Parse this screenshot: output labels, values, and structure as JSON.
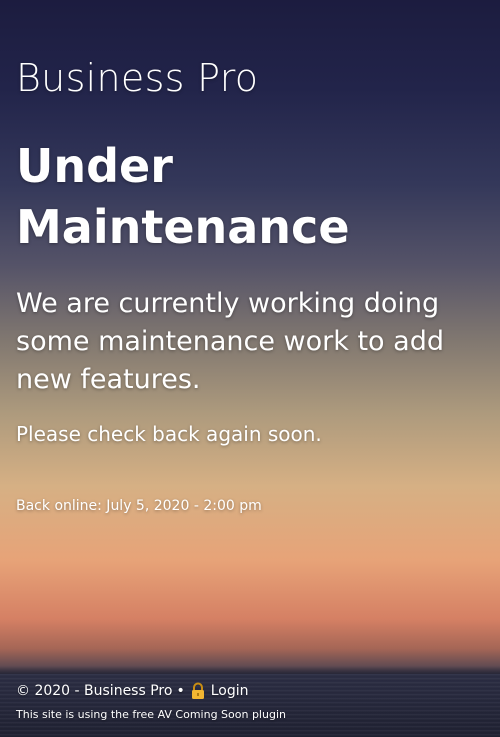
{
  "site": {
    "name": "Business Pro"
  },
  "main": {
    "headline": "Under Maintenance",
    "lead": "We are currently working doing some maintenance work to add new features.",
    "check_back": "Please check back again soon.",
    "back_online": "Back online: July 5, 2020 - 2:00 pm"
  },
  "footer": {
    "copyright": "© 2020 - Business Pro",
    "separator": "•",
    "login_label": "Login",
    "login_icon": "lock-icon",
    "plugin_note": "This site is using the free AV Coming Soon plugin"
  },
  "colors": {
    "text": "#ffffff",
    "sky_top": "#1c1c3f",
    "sky_horizon": "#e7a378",
    "sea": "#252739",
    "lock_icon": "#f2b632"
  }
}
